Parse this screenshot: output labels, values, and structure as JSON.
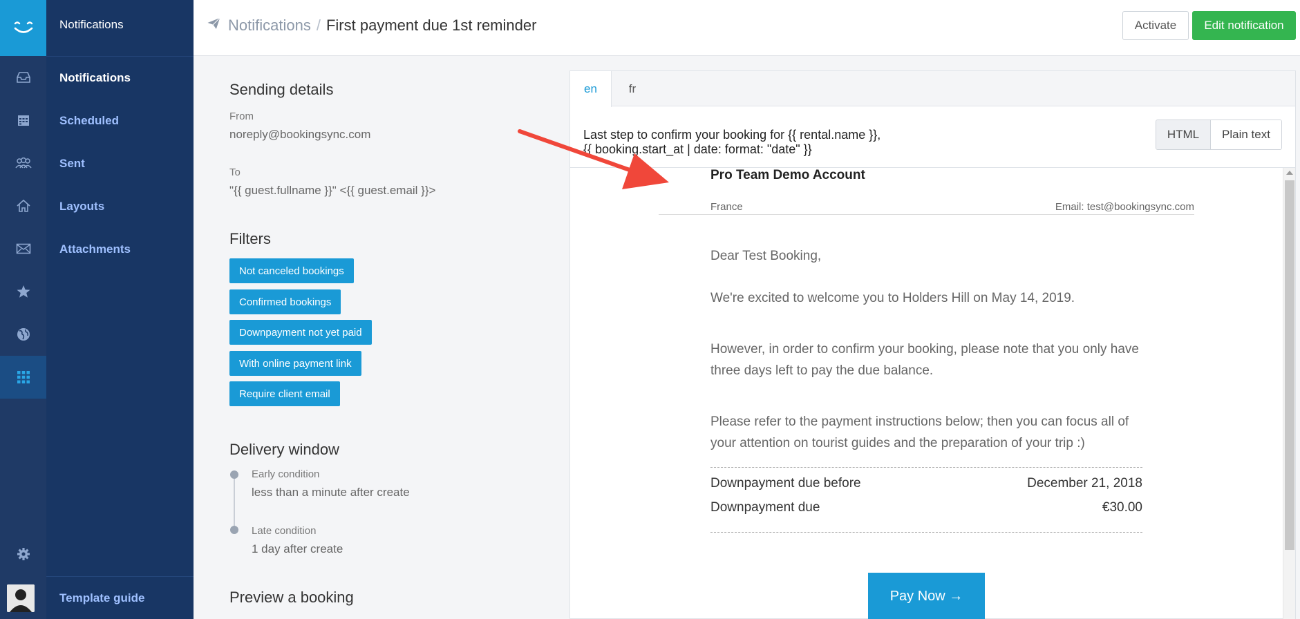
{
  "rail": {
    "icons": [
      "logo-icon",
      "inbox-icon",
      "calendar-icon",
      "users-icon",
      "home-icon",
      "envelope-icon",
      "star-icon",
      "globe-icon",
      "apps-grid-icon",
      "gear-icon"
    ],
    "active_icon": "apps-grid-icon"
  },
  "subnav": {
    "title": "Notifications",
    "items": [
      {
        "label": "Notifications",
        "active": true
      },
      {
        "label": "Scheduled",
        "active": false
      },
      {
        "label": "Sent",
        "active": false
      },
      {
        "label": "Layouts",
        "active": false
      },
      {
        "label": "Attachments",
        "active": false
      }
    ],
    "template_guide": "Template guide"
  },
  "header": {
    "breadcrumb_parent": "Notifications",
    "breadcrumb_separator": "/",
    "breadcrumb_current": "First payment due 1st reminder",
    "activate_label": "Activate",
    "edit_label": "Edit notification"
  },
  "sending": {
    "title": "Sending details",
    "from_label": "From",
    "from_value": "noreply@bookingsync.com",
    "to_label": "To",
    "to_value": "\"{{ guest.fullname }}\" <{{ guest.email }}>"
  },
  "filters": {
    "title": "Filters",
    "items": [
      "Not canceled bookings",
      "Confirmed bookings",
      "Downpayment not yet paid",
      "With online payment link",
      "Require client email"
    ]
  },
  "delivery": {
    "title": "Delivery window",
    "early_label": "Early condition",
    "early_value": "less than a minute after create",
    "late_label": "Late condition",
    "late_value": "1 day after create"
  },
  "preview_booking": {
    "title": "Preview a booking"
  },
  "preview": {
    "tabs": [
      "en",
      "fr"
    ],
    "active_tab": "en",
    "subject_line1": "Last step to confirm your booking for {{ rental.name }},",
    "subject_line2": "{{ booking.start_at | date: format: \"date\" }}",
    "format_html": "HTML",
    "format_plain": "Plain text",
    "company": "Pro Team Demo Account",
    "country": "France",
    "email": "Email: test@bookingsync.com",
    "greeting": "Dear Test Booking,",
    "p1": "We're excited to welcome you to Holders Hill on May 14, 2019.",
    "p2": "However, in order to confirm your booking, please note that you only have three days left to pay the due balance.",
    "p3": "Please refer to the payment instructions below; then you can focus all of your attention on tourist guides and the preparation of your trip :)",
    "rows": [
      {
        "label": "Downpayment due before",
        "value": "December 21, 2018"
      },
      {
        "label": "Downpayment due",
        "value": "€30.00"
      }
    ],
    "pay_button": "Pay Now →"
  },
  "colors": {
    "accent": "#1a9ad6",
    "success": "#34b550",
    "sidebar": "#183664",
    "annotation_arrow": "#f0473a"
  }
}
